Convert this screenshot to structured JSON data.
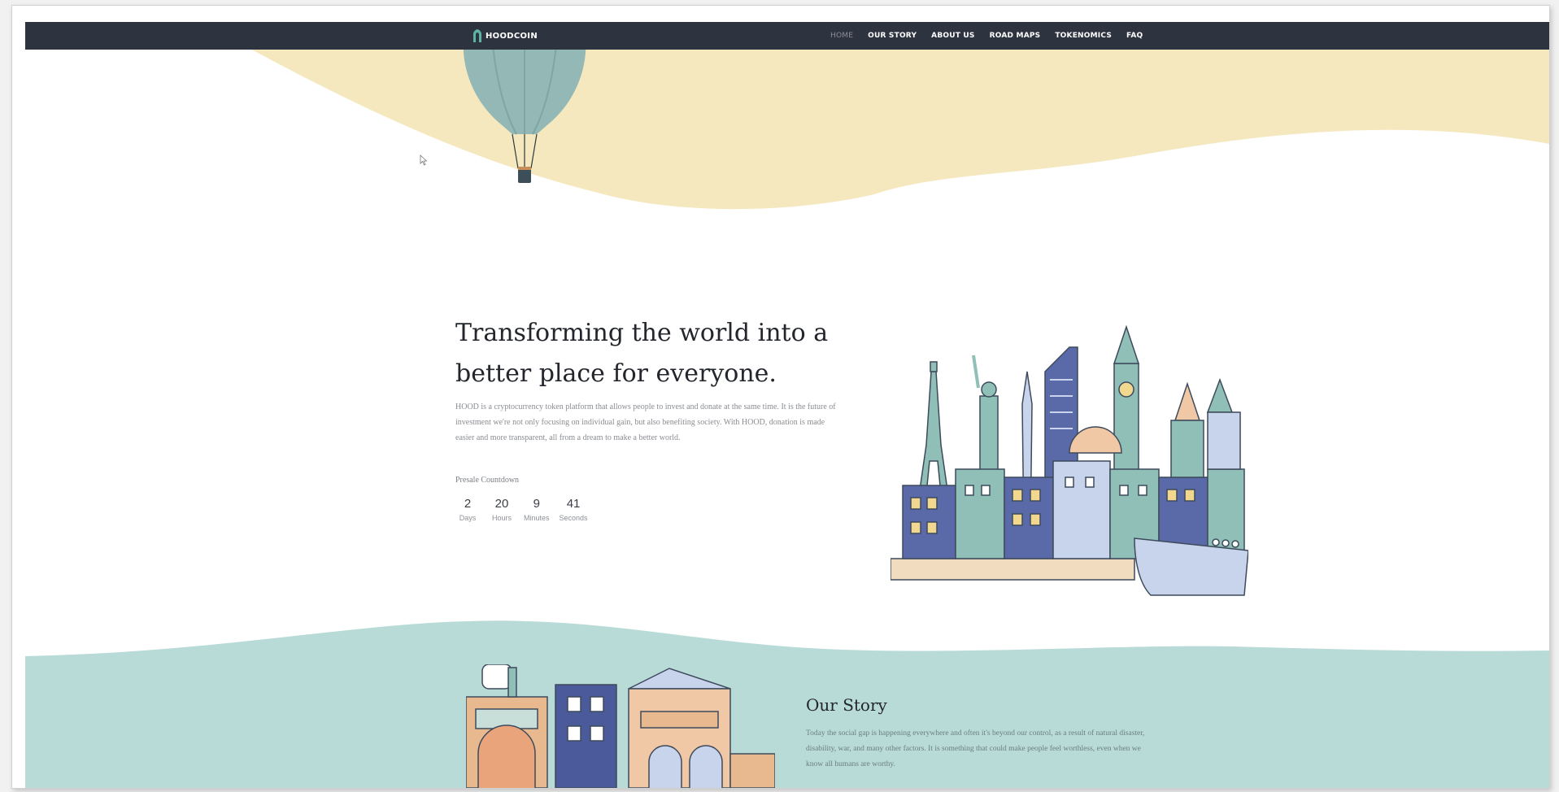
{
  "brand": {
    "name": "HOODCOIN"
  },
  "nav": {
    "items": [
      {
        "label": "HOME",
        "active": true
      },
      {
        "label": "OUR STORY",
        "active": false
      },
      {
        "label": "ABOUT US",
        "active": false
      },
      {
        "label": "ROAD MAPS",
        "active": false
      },
      {
        "label": "TOKENOMICS",
        "active": false
      },
      {
        "label": "FAQ",
        "active": false
      }
    ]
  },
  "hero": {
    "title": "Transforming the world into a better place for everyone.",
    "description": "HOOD is a cryptocurrency token platform that allows people to invest and donate at the same time. It is the future of investment we're not only focusing on individual gain, but also benefiting society. With HOOD, donation is made easier and more transparent, all from a dream to make a better world.",
    "countdown_label": "Presale Countdown",
    "countdown": [
      {
        "value": "2",
        "label": "Days"
      },
      {
        "value": "20",
        "label": "Hours"
      },
      {
        "value": "9",
        "label": "Minutes"
      },
      {
        "value": "41",
        "label": "Seconds"
      }
    ]
  },
  "story": {
    "title": "Our Story",
    "text": "Today the social gap is happening everywhere and often it's beyond our control, as a result of natural disaster, disability, war, and many other factors. It is something that could make people feel worthless, even when we know all humans are worthy."
  },
  "colors": {
    "navbar": "#2e3340",
    "sand_wave": "#f5e8be",
    "teal_wave": "#b8dbd7",
    "balloon": "#93b8b5",
    "text_dark": "#23262c"
  },
  "icons": {
    "logo": "hood-logo-icon",
    "cursor": "mouse-cursor-icon"
  }
}
